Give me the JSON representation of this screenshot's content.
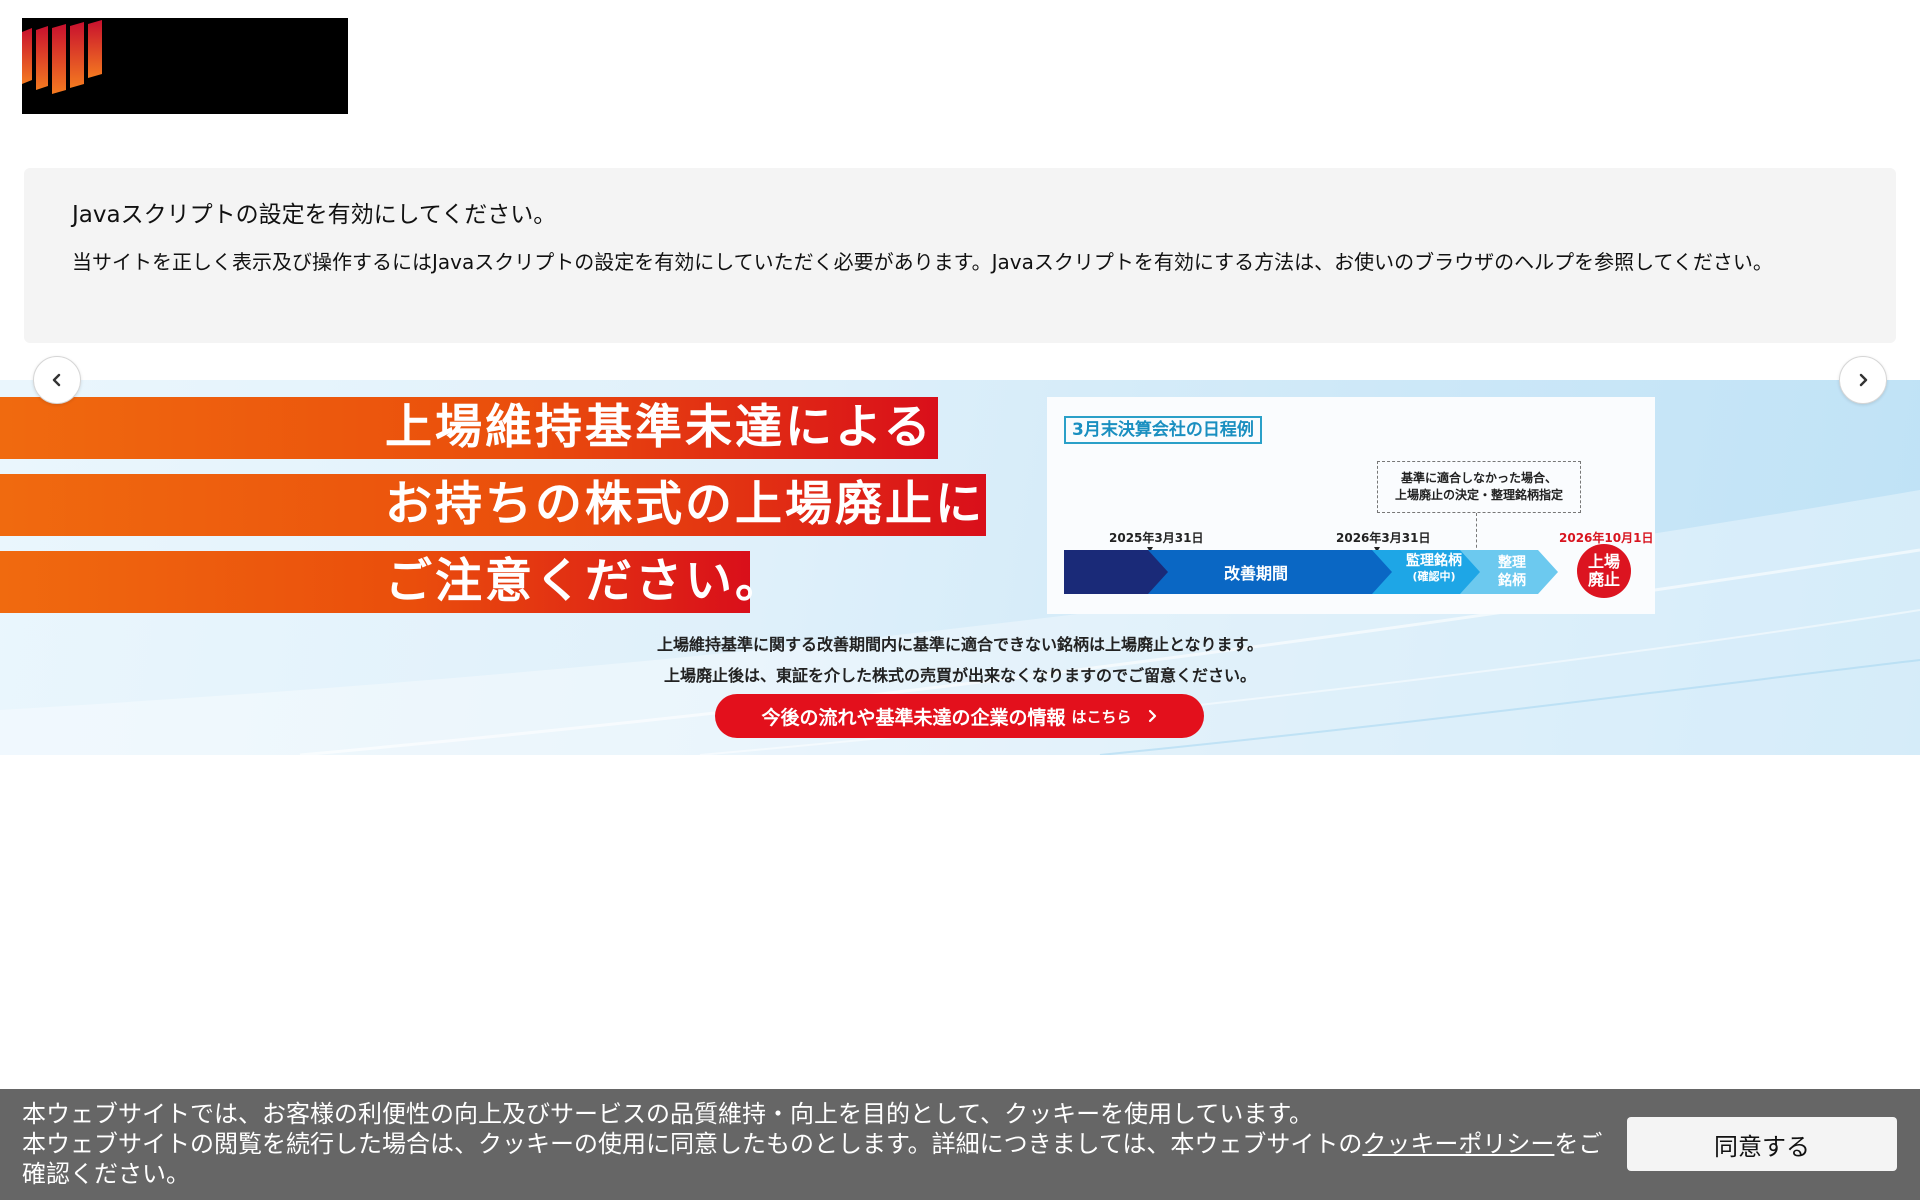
{
  "notice": {
    "title": "Javaスクリプトの設定を有効にしてください。",
    "body": "当サイトを正しく表示及び操作するにはJavaスクリプトの設定を有効にしていただく必要があります。Javaスクリプトを有効にする方法は、お使いのブラウザのヘルプを参照してください。"
  },
  "banner": {
    "headline": [
      "上場維持基準未達による",
      "お持ちの株式の上場廃止に",
      "ご注意ください。"
    ],
    "schedule": {
      "title": "3月末決算会社の日程例",
      "note_line1": "基準に適合しなかった場合、",
      "note_line2": "上場廃止の決定・整理銘柄指定",
      "date1": "2025年3月31日",
      "date2": "2026年3月31日",
      "date3": "2026年10月1日",
      "phase_improvement": "改善期間",
      "phase_supervision": "監理銘柄",
      "phase_supervision_sub": "(確認中)",
      "phase_liquidation_1": "整理",
      "phase_liquidation_2": "銘柄",
      "end_line1": "上場",
      "end_line2": "廃止"
    },
    "desc_line1": "上場維持基準に関する改善期間内に基準に適合できない銘柄は上場廃止となります。",
    "desc_line2": "上場廃止後は、東証を介した株式の売買が出来なくなりますのでご留意ください。",
    "cta_main": "今後の流れや基準未達の企業の情報",
    "cta_sub": "はこちら"
  },
  "carousel": {
    "prev_icon": "chevron-left-icon",
    "next_icon": "chevron-right-icon"
  },
  "cookie": {
    "line1": "本ウェブサイトでは、お客様の利便性の向上及びサービスの品質維持・向上を目的として、クッキーを使用しています。",
    "line2_pre": "本ウェブサイトの閲覧を続行した場合は、クッキーの使用に同意したものとします。詳細につきましては、本ウェブサイトの",
    "link": "クッキーポリシー",
    "line2_post": "をご確認ください。",
    "agree_label": "同意する"
  },
  "colors": {
    "accent_red": "#e3101c",
    "banner_orange": "#f06a0f",
    "navy": "#1a2a78",
    "blue": "#0a67c4",
    "light_blue": "#1ea6e6",
    "cookie_bg": "#666666"
  }
}
